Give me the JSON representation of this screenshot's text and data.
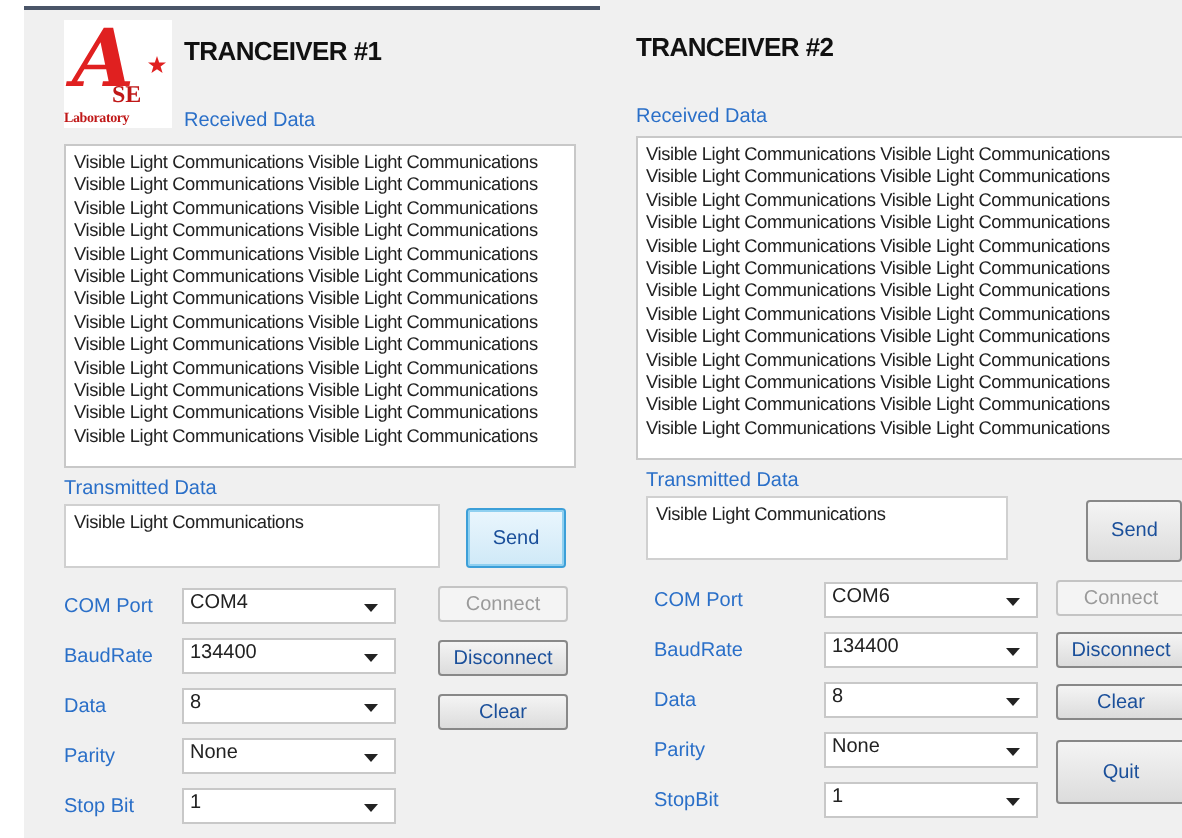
{
  "logo": {
    "letter": "A",
    "initials": "SE",
    "caption": "Laboratory"
  },
  "transceivers": [
    {
      "title": "TRANCEIVER #1",
      "received_label": "Received Data",
      "received_lines": [
        "Visible Light Communications Visible Light Communications",
        "Visible Light Communications Visible Light Communications",
        "Visible Light Communications Visible Light Communications",
        "Visible Light Communications Visible Light Communications",
        "Visible Light Communications Visible Light Communications",
        "Visible Light Communications Visible Light Communications",
        "Visible Light Communications Visible Light Communications",
        "Visible Light Communications Visible Light Communications",
        "Visible Light Communications Visible Light Communications",
        "Visible Light Communications Visible Light Communications",
        "Visible Light Communications Visible Light Communications",
        "Visible Light Communications Visible Light Communications",
        "Visible Light Communications Visible Light Communications"
      ],
      "transmitted_label": "Transmitted Data",
      "transmitted_value": "Visible Light Communications",
      "send": {
        "label": "Send",
        "focused": true
      },
      "settings": [
        {
          "label": "COM Port",
          "value": "COM4"
        },
        {
          "label": "BaudRate",
          "value": "134400"
        },
        {
          "label": "Data",
          "value": "8"
        },
        {
          "label": "Parity",
          "value": "None"
        },
        {
          "label": "Stop Bit",
          "value": "1"
        }
      ],
      "buttons": [
        {
          "label": "Connect",
          "disabled": true
        },
        {
          "label": "Disconnect",
          "disabled": false
        },
        {
          "label": "Clear",
          "disabled": false
        }
      ]
    },
    {
      "title": "TRANCEIVER #2",
      "received_label": "Received Data",
      "received_lines": [
        "Visible Light Communications Visible Light Communications",
        "Visible Light Communications Visible Light Communications",
        "Visible Light Communications Visible Light Communications",
        "Visible Light Communications Visible Light Communications",
        "Visible Light Communications Visible Light Communications",
        "Visible Light Communications Visible Light Communications",
        "Visible Light Communications Visible Light Communications",
        "Visible Light Communications Visible Light Communications",
        "Visible Light Communications Visible Light Communications",
        "Visible Light Communications Visible Light Communications",
        "Visible Light Communications Visible Light Communications",
        "Visible Light Communications Visible Light Communications",
        "Visible Light Communications Visible Light Communications"
      ],
      "transmitted_label": "Transmitted Data",
      "transmitted_value": "Visible Light Communications",
      "send": {
        "label": "Send",
        "focused": false
      },
      "settings": [
        {
          "label": "COM Port",
          "value": "COM6"
        },
        {
          "label": "BaudRate",
          "value": "134400"
        },
        {
          "label": "Data",
          "value": "8"
        },
        {
          "label": "Parity",
          "value": "None"
        },
        {
          "label": "StopBit",
          "value": "1"
        }
      ],
      "buttons": [
        {
          "label": "Connect",
          "disabled": true
        },
        {
          "label": "Disconnect",
          "disabled": false
        },
        {
          "label": "Clear",
          "disabled": false
        },
        {
          "label": "Quit",
          "disabled": false
        }
      ]
    }
  ]
}
